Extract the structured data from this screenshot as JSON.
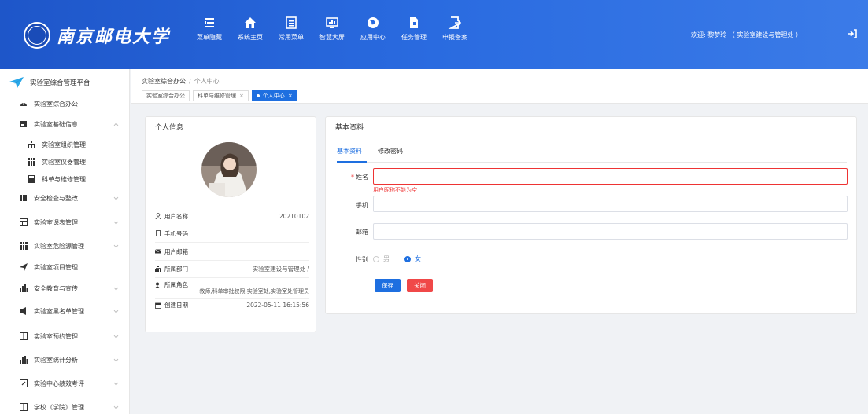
{
  "header": {
    "school_name": "南京邮电大学",
    "nav": [
      {
        "label": "菜单隐藏",
        "icon": "menu-fold-icon"
      },
      {
        "label": "系统主页",
        "icon": "home-icon"
      },
      {
        "label": "常用菜单",
        "icon": "list-icon"
      },
      {
        "label": "智慧大屏",
        "icon": "monitor-icon"
      },
      {
        "label": "应用中心",
        "icon": "globe-icon"
      },
      {
        "label": "任务管理",
        "icon": "document-icon"
      },
      {
        "label": "申报备案",
        "icon": "export-icon"
      }
    ],
    "welcome": "欢迎: 黎梦玲 （ 实验室建设与管理处 ）"
  },
  "sidebar": {
    "platform": "实验室综合管理平台",
    "items": [
      {
        "label": "实验室综合办公",
        "icon": "gauge-icon",
        "chevron": false
      },
      {
        "label": "实验室基础信息",
        "icon": "image-icon",
        "chevron": true,
        "open": true
      },
      {
        "label": "实验室组织管理",
        "icon": "org-icon",
        "sub": true
      },
      {
        "label": "实验室仪器管理",
        "icon": "grid-icon",
        "sub": true
      },
      {
        "label": "科单与维修管理",
        "icon": "save-icon",
        "sub": true
      },
      {
        "label": "安全检查与整改",
        "icon": "book-icon",
        "chevron": true
      },
      {
        "label": "实验室课表管理",
        "icon": "table-icon",
        "chevron": true
      },
      {
        "label": "实验室危险源管理",
        "icon": "grid-icon",
        "chevron": true
      },
      {
        "label": "实验室项目管理",
        "icon": "send-icon",
        "chevron": false
      },
      {
        "label": "安全教育与宣传",
        "icon": "bar-chart-icon",
        "chevron": true
      },
      {
        "label": "实验室黑名单管理",
        "icon": "volume-icon",
        "chevron": true
      },
      {
        "label": "实验室预约管理",
        "icon": "columns-icon",
        "chevron": true
      },
      {
        "label": "实验室统计分析",
        "icon": "bar-chart-icon",
        "chevron": true
      },
      {
        "label": "实验中心绩效考评",
        "icon": "edit-icon",
        "chevron": true
      },
      {
        "label": "学校（学院）管理",
        "icon": "columns-icon",
        "chevron": true
      }
    ]
  },
  "breadcrumb": {
    "root": "实验室综合办公",
    "sep": "/",
    "current": "个人中心"
  },
  "tags": [
    {
      "label": "实验室综合办公",
      "closable": false
    },
    {
      "label": "科单与维修管理",
      "closable": true
    },
    {
      "label": "个人中心",
      "closable": true,
      "active": true
    }
  ],
  "profile": {
    "title": "个人信息",
    "rows": [
      {
        "key": "用户名称",
        "value": "20210102",
        "icon": "user-icon"
      },
      {
        "key": "手机号码",
        "value": "",
        "icon": "phone-icon"
      },
      {
        "key": "用户邮箱",
        "value": "",
        "icon": "mail-icon"
      },
      {
        "key": "所属部门",
        "value": "实验室建设与管理处 /",
        "icon": "org-icon"
      },
      {
        "key": "所属角色",
        "value": "教师,科单审批权限,实验室处,实验室处管理员",
        "icon": "users-icon"
      },
      {
        "key": "创建日期",
        "value": "2022-05-11 16:15:56",
        "icon": "calendar-icon"
      }
    ]
  },
  "basic": {
    "title": "基本资料",
    "tabs": [
      "基本资料",
      "修改密码"
    ],
    "name_label": "姓名",
    "name_required": "*",
    "name_value": "",
    "name_error": "用户昵称不能为空",
    "phone_label": "手机",
    "phone_value": "",
    "email_label": "邮箱",
    "email_value": "",
    "gender_label": "性别",
    "gender_male": "男",
    "gender_female": "女",
    "save_label": "保存",
    "close_label": "关闭"
  },
  "colors": {
    "primary": "#1e6fe0",
    "danger": "#f04848",
    "header": "#2a6be0"
  }
}
